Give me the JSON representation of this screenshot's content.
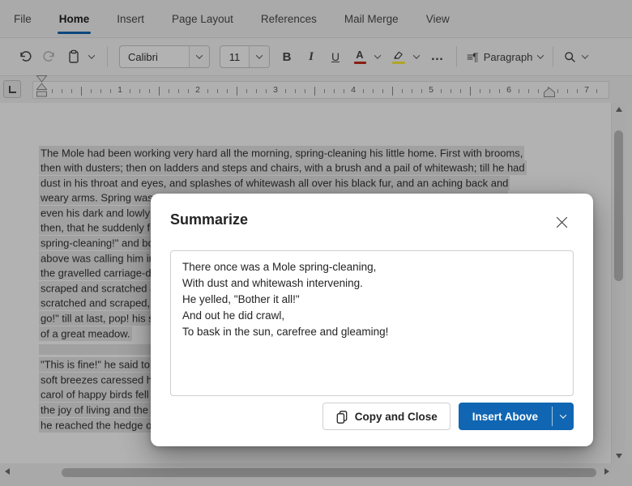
{
  "menubar": {
    "tabs": [
      {
        "label": "File",
        "active": false
      },
      {
        "label": "Home",
        "active": true
      },
      {
        "label": "Insert",
        "active": false
      },
      {
        "label": "Page Layout",
        "active": false
      },
      {
        "label": "References",
        "active": false
      },
      {
        "label": "Mail Merge",
        "active": false
      },
      {
        "label": "View",
        "active": false
      }
    ]
  },
  "toolbar": {
    "font_name": "Calibri",
    "font_size": "11",
    "bold_label": "B",
    "italic_label": "I",
    "underline_label": "U",
    "font_color_label": "A",
    "more_label": "…",
    "paragraph_icon_glyph": "≡¶",
    "paragraph_label": "Paragraph"
  },
  "ruler": {
    "unit_labels": [
      "1",
      "2",
      "3",
      "4",
      "5",
      "6",
      "7"
    ]
  },
  "document": {
    "paragraphs": [
      {
        "lines": [
          "The Mole had been working very hard all the morning, spring-cleaning his little home. First with brooms,",
          "then with dusters; then on ladders and steps and chairs, with a brush and a pail of whitewash; till he had",
          "dust in his throat and eyes, and splashes of whitewash all over his black fur, and an aching back and",
          "weary arms. Spring was moving in the air above and in the earth below and around him, penetrating",
          "even his dark and lowly little house with its spirit of divine discontent and longing. It was small wonder,",
          "then, that he suddenly flung down his brush on the floor, said \"Bother!\" and \"O blow!\" and also \"Hang",
          "spring-cleaning!\" and bolted out of the house without even waiting to put on his coat. Something up",
          "above was calling him imperiously, and he made for the steep little tunnel which answered in his case to",
          "the gravelled carriage-drive owned by animals whose residences are nearer to the sun and air. So he",
          "scraped and scratched and scrabbled and scrooged and then he scrooged again and scrabbled and",
          "scratched and scraped, working busily with his little paws and muttering to himself, \"Up we go! Up we",
          "go!\" till at last, pop! his snout came out into the sunlight, and he found himself rolling in the warm grass",
          "of a great meadow."
        ]
      },
      {
        "lines": [
          "\"This is fine!\" he said to himself. \"This is better than whitewashing!\" The sunshine struck hot on his fur,",
          "soft breezes caressed his heated brow, and after the seclusion of the cellarage he had lived in so long the",
          "carol of happy birds fell on his dulled hearing almost like a shout. Jumping off all his four legs at once, in",
          "the joy of living and the delight of spring without its cleaning, he pranced along the side of the meadow till",
          "he reached the hedge on the further side."
        ]
      }
    ],
    "selection": "all visible text selected"
  },
  "dialog": {
    "title": "Summarize",
    "content": "There once was a Mole spring-cleaning,\nWith dust and whitewash intervening.\nHe yelled, \"Bother it all!\"\nAnd out he did crawl,\nTo bask in the sun, carefree and gleaming!",
    "copy_close_label": "Copy and Close",
    "insert_above_label": "Insert Above"
  },
  "colors": {
    "accent": "#1066b2",
    "selection_highlight": "#e7e7e7",
    "font_color_indicator": "#c42b1c",
    "highlight_indicator": "#fdee3a"
  }
}
